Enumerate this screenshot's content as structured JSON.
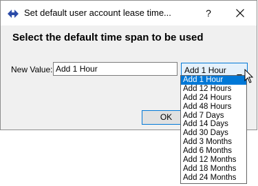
{
  "window": {
    "title": "Set default user account lease time...",
    "help_label": "?"
  },
  "main": {
    "heading": "Select the default time span to be used",
    "new_value_label": "New Value:",
    "new_value_text": "Add 1 Hour",
    "ok_label": "OK"
  },
  "timespan_select": {
    "selected": "Add 1 Hour",
    "options": [
      "Add 1 Hour",
      "Add 12 Hours",
      "Add 24 Hours",
      "Add 48 Hours",
      "Add 7 Days",
      "Add 14 Days",
      "Add 30 Days",
      "Add 3 Months",
      "Add 6 Months",
      "Add 12 Months",
      "Add 18 Months",
      "Add 24 Months"
    ]
  },
  "colors": {
    "accent": "#0078d7",
    "dialog_bg": "#f0f0f0",
    "app_icon": "#2b4ba8"
  },
  "icons": {
    "app": "diamond-arrows-icon",
    "close": "close-icon",
    "dropdown": "chevron-down-icon",
    "cursor": "mouse-pointer-icon"
  }
}
